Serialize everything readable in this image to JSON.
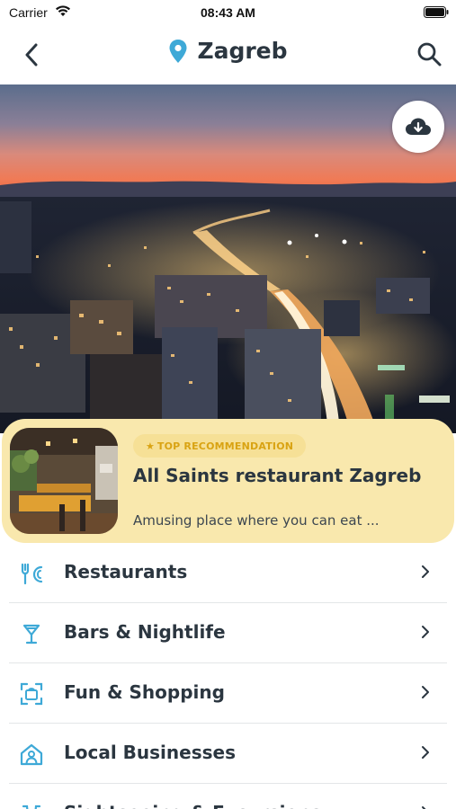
{
  "status_bar": {
    "carrier": "Carrier",
    "time": "08:43 AM"
  },
  "nav": {
    "title": "Zagreb",
    "back_icon": "chevron-left-icon",
    "location_icon": "map-pin-icon",
    "search_icon": "search-icon"
  },
  "hero": {
    "download_icon": "cloud-download-icon"
  },
  "recommendation": {
    "badge": "TOP RECOMMENDATION",
    "title": "All Saints restaurant Zagreb",
    "description": "Amusing place where you can eat ..."
  },
  "categories": [
    {
      "label": "Restaurants",
      "icon": "fork-knife-icon"
    },
    {
      "label": "Bars & Nightlife",
      "icon": "cocktail-icon"
    },
    {
      "label": "Fun & Shopping",
      "icon": "shopping-scan-icon"
    },
    {
      "label": "Local Businesses",
      "icon": "home-person-icon"
    },
    {
      "label": "Sightseeing & Excursions",
      "icon": "binoculars-icon"
    }
  ],
  "colors": {
    "accent": "#3ea9d7",
    "card": "#f9e8ad",
    "badge_text": "#d9a313",
    "text": "#2b3640"
  }
}
